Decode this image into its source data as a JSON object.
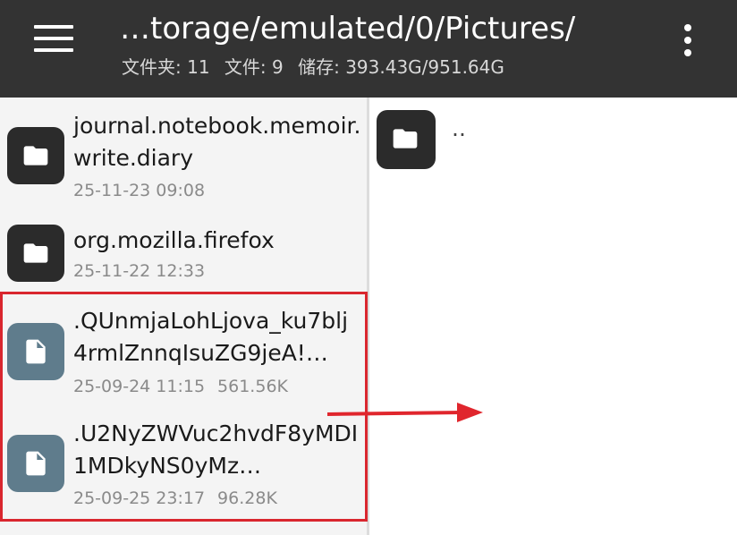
{
  "appbar": {
    "path": "…torage/emulated/0/Pictures/",
    "stats": [
      "文件夹: 11",
      "文件: 9",
      "储存: 393.43G/951.64G"
    ],
    "menu_icon": "hamburger-menu-icon",
    "overflow_icon": "more-vertical-icon"
  },
  "left_pane": {
    "items": [
      {
        "type": "folder",
        "icon": "folder-icon",
        "name": "journal.notebook.memoir.write.diary",
        "date": "25-11-23 09:08",
        "size": ""
      },
      {
        "type": "folder",
        "icon": "folder-icon",
        "name": "org.mozilla.firefox",
        "date": "25-11-22 12:33",
        "size": ""
      },
      {
        "type": "file",
        "icon": "file-icon",
        "name": ".QUnmjaLohLjova_ku7blj4rmlZnnqIsuZG9jeA!…",
        "date": "25-09-24 11:15",
        "size": "561.56K"
      },
      {
        "type": "file",
        "icon": "file-icon",
        "name": ".U2NyZWVuc2hvdF8yMDI1MDkyNS0yMz…",
        "date": "25-09-25 23:17",
        "size": "96.28K"
      }
    ]
  },
  "right_pane": {
    "parent_label": "..",
    "parent_icon": "folder-icon"
  },
  "colors": {
    "appbar": "#333333",
    "folder_tile": "#2b2b2b",
    "file_tile": "#5f7c8c",
    "highlight": "#d9262e",
    "left_pane_bg": "#f4f4f4"
  }
}
